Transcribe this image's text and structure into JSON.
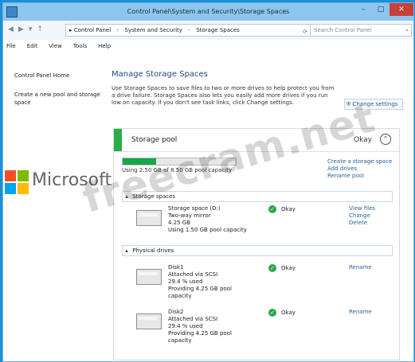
{
  "window": {
    "title": "Control Panel\\System and Security\\Storage Spaces"
  },
  "address": {
    "crumbs": [
      "Control Panel",
      "System and Security",
      "Storage Spaces"
    ],
    "search_placeholder": "Search Control Panel"
  },
  "menu": [
    "File",
    "Edit",
    "View",
    "Tools",
    "Help"
  ],
  "sidebar": {
    "links": [
      "Control Panel Home",
      "Create a new pool and storage space"
    ]
  },
  "main": {
    "heading": "Manage Storage Spaces",
    "intro": "Use Storage Spaces to save files to two or more drives to help protect you from a drive failure. Storage Spaces also lets you easily add more drives if you run low on capacity. If you don't see task links, click Change settings.",
    "change_settings_label": "Change settings"
  },
  "pool": {
    "name": "Storage pool",
    "status": "Okay",
    "capacity_fraction": 0.294,
    "capacity_text": "Using 2.50 GB of 8.50 GB pool capacity",
    "links": [
      "Create a storage space",
      "Add drives",
      "Rename pool"
    ],
    "storage_spaces_label": "Storage spaces",
    "storage_space": {
      "lines": [
        "Storage space (D:)",
        "Two-way mirror",
        "4.25 GB",
        "Using 1.50 GB pool capacity"
      ],
      "status": "Okay",
      "actions": [
        "View files",
        "Change",
        "Delete"
      ]
    },
    "physical_drives_label": "Physical drives",
    "drives": [
      {
        "lines": [
          "Disk1",
          "Attached via SCSI",
          "29.4 % used",
          "Providing 4.25 GB pool",
          "capacity"
        ],
        "status": "Okay",
        "action": "Rename"
      },
      {
        "lines": [
          "Disk2",
          "Attached via SCSI",
          "29.4 % used",
          "Providing 4.25 GB pool",
          "capacity"
        ],
        "status": "Okay",
        "action": "Rename"
      }
    ]
  },
  "watermark": {
    "brand": "Microsoft",
    "site": "freecram.net"
  },
  "colors": {
    "accent": "#2bad4a",
    "titlebar": "#8cc6ef",
    "close": "#c7403a",
    "link": "#2a5f9a",
    "logo": [
      "#f25022",
      "#7fba00",
      "#00a4ef",
      "#ffb900"
    ]
  }
}
